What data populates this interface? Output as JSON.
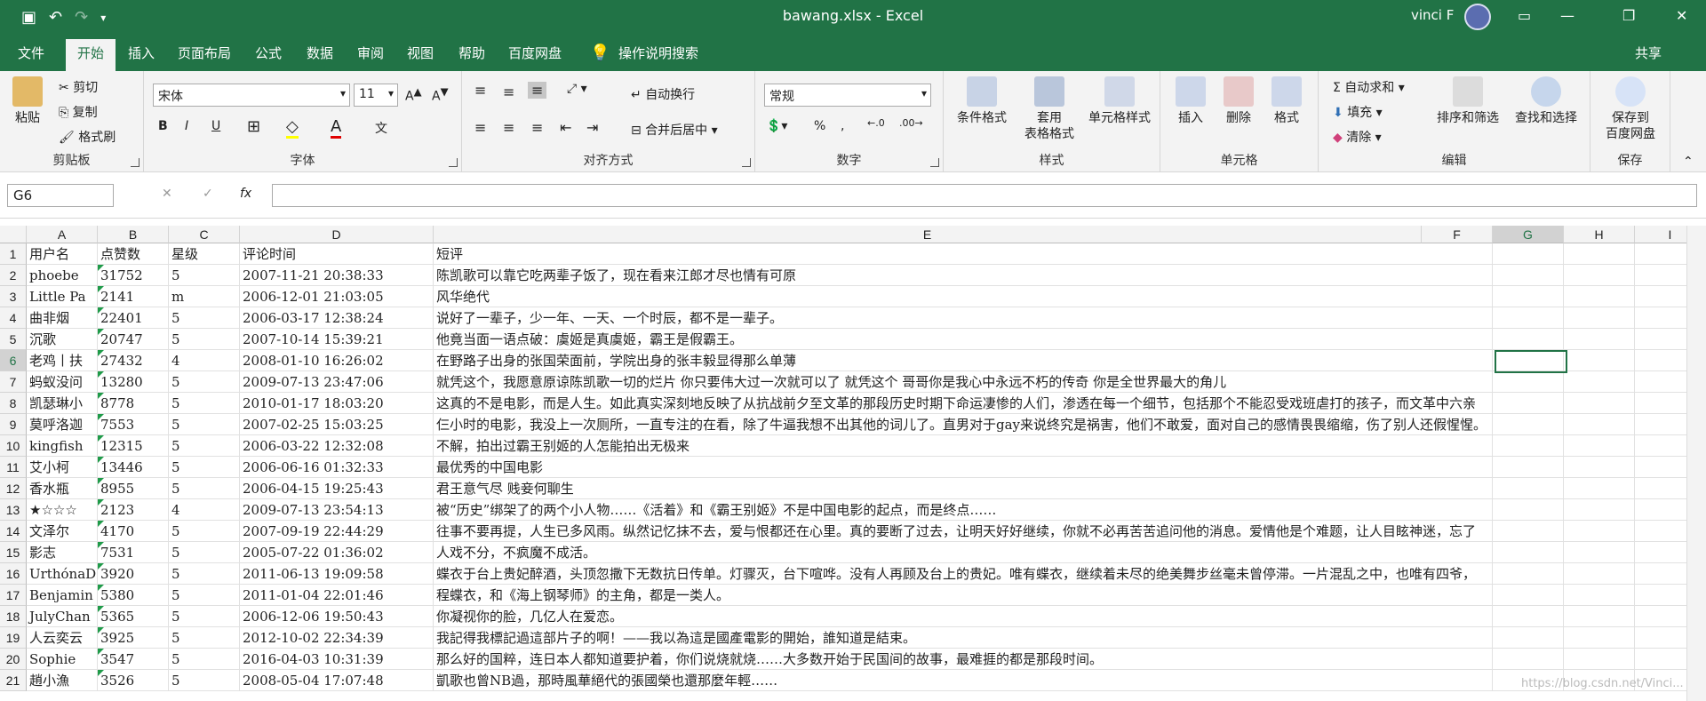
{
  "titlebar": {
    "title": "bawang.xlsx  -  Excel",
    "user": "vinci F"
  },
  "tabs": [
    "文件",
    "开始",
    "插入",
    "页面布局",
    "公式",
    "数据",
    "审阅",
    "视图",
    "帮助",
    "百度网盘",
    "操作说明搜索"
  ],
  "share": "共享",
  "ribbon": {
    "clipboard": {
      "paste": "粘贴",
      "cut": "剪切",
      "copy": "复制",
      "format_painter": "格式刷",
      "label": "剪贴板"
    },
    "font": {
      "name": "宋体",
      "size": "11",
      "label": "字体"
    },
    "alignment": {
      "wrap": "自动换行",
      "merge": "合并后居中",
      "label": "对齐方式"
    },
    "number": {
      "format": "常规",
      "label": "数字"
    },
    "styles": {
      "cond": "条件格式",
      "table": "套用\n表格格式",
      "cell": "单元格样式",
      "label": "样式"
    },
    "cells": {
      "insert": "插入",
      "delete": "删除",
      "format": "格式",
      "label": "单元格"
    },
    "editing": {
      "autosum": "自动求和",
      "fill": "填充",
      "clear": "清除",
      "sort": "排序和筛选",
      "find": "查找和选择",
      "label": "编辑"
    },
    "save": {
      "btn": "保存到\n百度网盘",
      "label": "保存"
    }
  },
  "formula_bar": {
    "name_box": "G6",
    "fx": "fx",
    "value": ""
  },
  "columns": [
    "A",
    "B",
    "C",
    "D",
    "E",
    "F",
    "G",
    "H",
    "I"
  ],
  "rows": [
    {
      "n": "1",
      "cells": [
        "用户名",
        "点赞数",
        "星级",
        "评论时间",
        "短评"
      ]
    },
    {
      "n": "2",
      "cells": [
        "phoebe",
        "31752",
        "5",
        "2007-11-21 20:38:33",
        "陈凯歌可以靠它吃两辈子饭了，现在看来江郎才尽也情有可原"
      ]
    },
    {
      "n": "3",
      "cells": [
        "Little Pa",
        "2141",
        "m",
        "2006-12-01 21:03:05",
        "风华绝代"
      ]
    },
    {
      "n": "4",
      "cells": [
        "曲非烟",
        "22401",
        "5",
        "2006-03-17 12:38:24",
        "说好了一辈子，少一年、一天、一个时辰，都不是一辈子。"
      ]
    },
    {
      "n": "5",
      "cells": [
        "沉歌",
        "20747",
        "5",
        "2007-10-14 15:39:21",
        "他竟当面一语点破：虞姬是真虞姬，霸王是假霸王。"
      ]
    },
    {
      "n": "6",
      "cells": [
        "老鸡丨扶",
        "27432",
        "4",
        "2008-01-10 16:26:02",
        "在野路子出身的张国荣面前，学院出身的张丰毅显得那么单薄"
      ]
    },
    {
      "n": "7",
      "cells": [
        "蚂蚁没问",
        "13280",
        "5",
        "2009-07-13 23:47:06",
        "就凭这个，我愿意原谅陈凯歌一切的烂片 你只要伟大过一次就可以了 就凭这个 哥哥你是我心中永远不朽的传奇 你是全世界最大的角儿"
      ]
    },
    {
      "n": "8",
      "cells": [
        "凯瑟琳小",
        "8778",
        "5",
        "2010-01-17 18:03:20",
        "这真的不是电影，而是人生。如此真实深刻地反映了从抗战前夕至文革的那段历史时期下命运凄惨的人们，渗透在每一个细节，包括那个不能忍受戏班虐打的孩子，而文革中六亲"
      ]
    },
    {
      "n": "9",
      "cells": [
        "莫呼洛迦",
        "7553",
        "5",
        "2007-02-25 15:03:25",
        "仨小时的电影，我没上一次厕所，一直专注的在看，除了牛逼我想不出其他的词儿了。直男对于gay来说终究是祸害，他们不敢爱，面对自己的感情畏畏缩缩，伤了别人还假惺惺。"
      ]
    },
    {
      "n": "10",
      "cells": [
        "kingfish",
        "12315",
        "5",
        "2006-03-22 12:32:08",
        "不解，拍出过霸王别姬的人怎能拍出无极来"
      ]
    },
    {
      "n": "11",
      "cells": [
        "艾小柯",
        "13446",
        "5",
        "2006-06-16 01:32:33",
        "最优秀的中国电影"
      ]
    },
    {
      "n": "12",
      "cells": [
        "香水瓶",
        "8955",
        "5",
        "2006-04-15 19:25:43",
        "君王意气尽 贱妾何聊生"
      ]
    },
    {
      "n": "13",
      "cells": [
        "★☆☆☆",
        "2123",
        "4",
        "2009-07-13 23:54:13",
        "被“历史”绑架了的两个小人物……《活着》和《霸王别姬》不是中国电影的起点，而是终点……"
      ]
    },
    {
      "n": "14",
      "cells": [
        "文泽尔",
        "4170",
        "5",
        "2007-09-19 22:44:29",
        "往事不要再提，人生已多风雨。纵然记忆抹不去，爱与恨都还在心里。真的要断了过去，让明天好好继续，你就不必再苦苦追问他的消息。爱情他是个难题，让人目眩神迷，忘了"
      ]
    },
    {
      "n": "15",
      "cells": [
        "影志",
        "7531",
        "5",
        "2005-07-22 01:36:02",
        "人戏不分，不疯魔不成活。"
      ]
    },
    {
      "n": "16",
      "cells": [
        "UrthónaD",
        "3920",
        "5",
        "2011-06-13 19:09:58",
        "蝶衣于台上贵妃醉酒，头顶忽撒下无数抗日传单。灯骤灭，台下喧哗。没有人再顾及台上的贵妃。唯有蝶衣，继续着未尽的绝美舞步丝毫未曾停滞。一片混乱之中，也唯有四爷，"
      ]
    },
    {
      "n": "17",
      "cells": [
        "Benjamin",
        "5380",
        "5",
        "2011-01-04 22:01:46",
        "程蝶衣，和《海上钢琴师》的主角，都是一类人。"
      ]
    },
    {
      "n": "18",
      "cells": [
        "JulyChan",
        "5365",
        "5",
        "2006-12-06 19:50:43",
        "你凝视你的脸，几亿人在爱恋。"
      ]
    },
    {
      "n": "19",
      "cells": [
        "人云奕云",
        "3925",
        "5",
        "2012-10-02 22:34:39",
        "我記得我標記過這部片子的啊！——我以為這是國產電影的開始，誰知道是結束。"
      ]
    },
    {
      "n": "20",
      "cells": [
        "Sophie",
        "3547",
        "5",
        "2016-04-03 10:31:39",
        "那么好的国粹，连日本人都知道要护着，你们说烧就烧……大多数开始于民国间的故事，最难捱的都是那段时间。"
      ]
    },
    {
      "n": "21",
      "cells": [
        "趙小漁",
        "3526",
        "5",
        "2008-05-04 17:07:48",
        "凱歌也曾NB過，那時風華絕代的張國榮也還那麼年輕……"
      ]
    }
  ],
  "watermark": "https://blog.csdn.net/Vinci..."
}
